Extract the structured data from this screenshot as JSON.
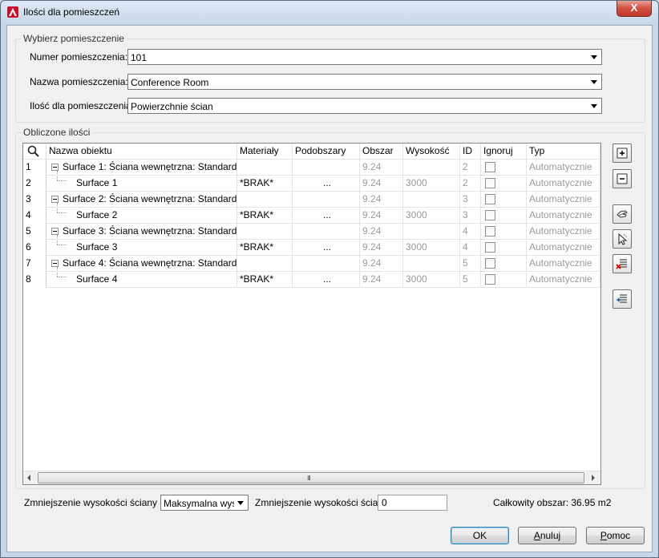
{
  "window": {
    "title": "Ilości dla pomieszczeń",
    "close_label": "X"
  },
  "select_group": {
    "legend": "Wybierz pomieszczenie",
    "room_number_label": "Numer pomieszczenia:",
    "room_number_value": "101",
    "room_name_label": "Nazwa pomieszczenia:",
    "room_name_value": "Conference Room",
    "quantity_label": "Ilość dla pomieszczenia:",
    "quantity_value": "Powierzchnie ścian"
  },
  "calc_group": {
    "legend": "Obliczone ilości",
    "columns": [
      "Nazwa obiektu",
      "Materiały",
      "Podobszary",
      "Obszar",
      "Wysokość",
      "ID",
      "Ignoruj",
      "Typ"
    ],
    "rows": [
      {
        "num": "1",
        "name": "Surface 1: Ściana wewnętrzna: Standard",
        "material": "",
        "sub": "",
        "area": "9.24",
        "height": "",
        "id": "2",
        "type": "Automatycznie"
      },
      {
        "num": "2",
        "name": "Surface 1",
        "material": "*BRAK*",
        "sub": "...",
        "area": "9.24",
        "height": "3000",
        "id": "2",
        "type": "Automatycznie"
      },
      {
        "num": "3",
        "name": "Surface 2: Ściana wewnętrzna: Standard",
        "material": "",
        "sub": "",
        "area": "9.24",
        "height": "",
        "id": "3",
        "type": "Automatycznie"
      },
      {
        "num": "4",
        "name": "Surface 2",
        "material": "*BRAK*",
        "sub": "...",
        "area": "9.24",
        "height": "3000",
        "id": "3",
        "type": "Automatycznie"
      },
      {
        "num": "5",
        "name": "Surface 3: Ściana wewnętrzna: Standard",
        "material": "",
        "sub": "",
        "area": "9.24",
        "height": "",
        "id": "4",
        "type": "Automatycznie"
      },
      {
        "num": "6",
        "name": "Surface 3",
        "material": "*BRAK*",
        "sub": "...",
        "area": "9.24",
        "height": "3000",
        "id": "4",
        "type": "Automatycznie"
      },
      {
        "num": "7",
        "name": "Surface 4: Ściana wewnętrzna: Standard",
        "material": "",
        "sub": "",
        "area": "9.24",
        "height": "",
        "id": "5",
        "type": "Automatycznie"
      },
      {
        "num": "8",
        "name": "Surface 4",
        "material": "*BRAK*",
        "sub": "...",
        "area": "9.24",
        "height": "3000",
        "id": "5",
        "type": "Automatycznie"
      }
    ],
    "scroll_grip": "III"
  },
  "bottom": {
    "reduction_from_label": "Zmniejszenie wysokości ściany od",
    "reduction_from_value": "Maksymalna wyso",
    "reduction_label": "Zmniejszenie wysokości ściany",
    "reduction_value": "0",
    "total_area_label": "Całkowity obszar: 36.95 m2"
  },
  "buttons": {
    "ok": "OK",
    "cancel_underlined": "A",
    "cancel_rest": "nuluj",
    "help_underlined": "P",
    "help_rest": "omoc"
  }
}
